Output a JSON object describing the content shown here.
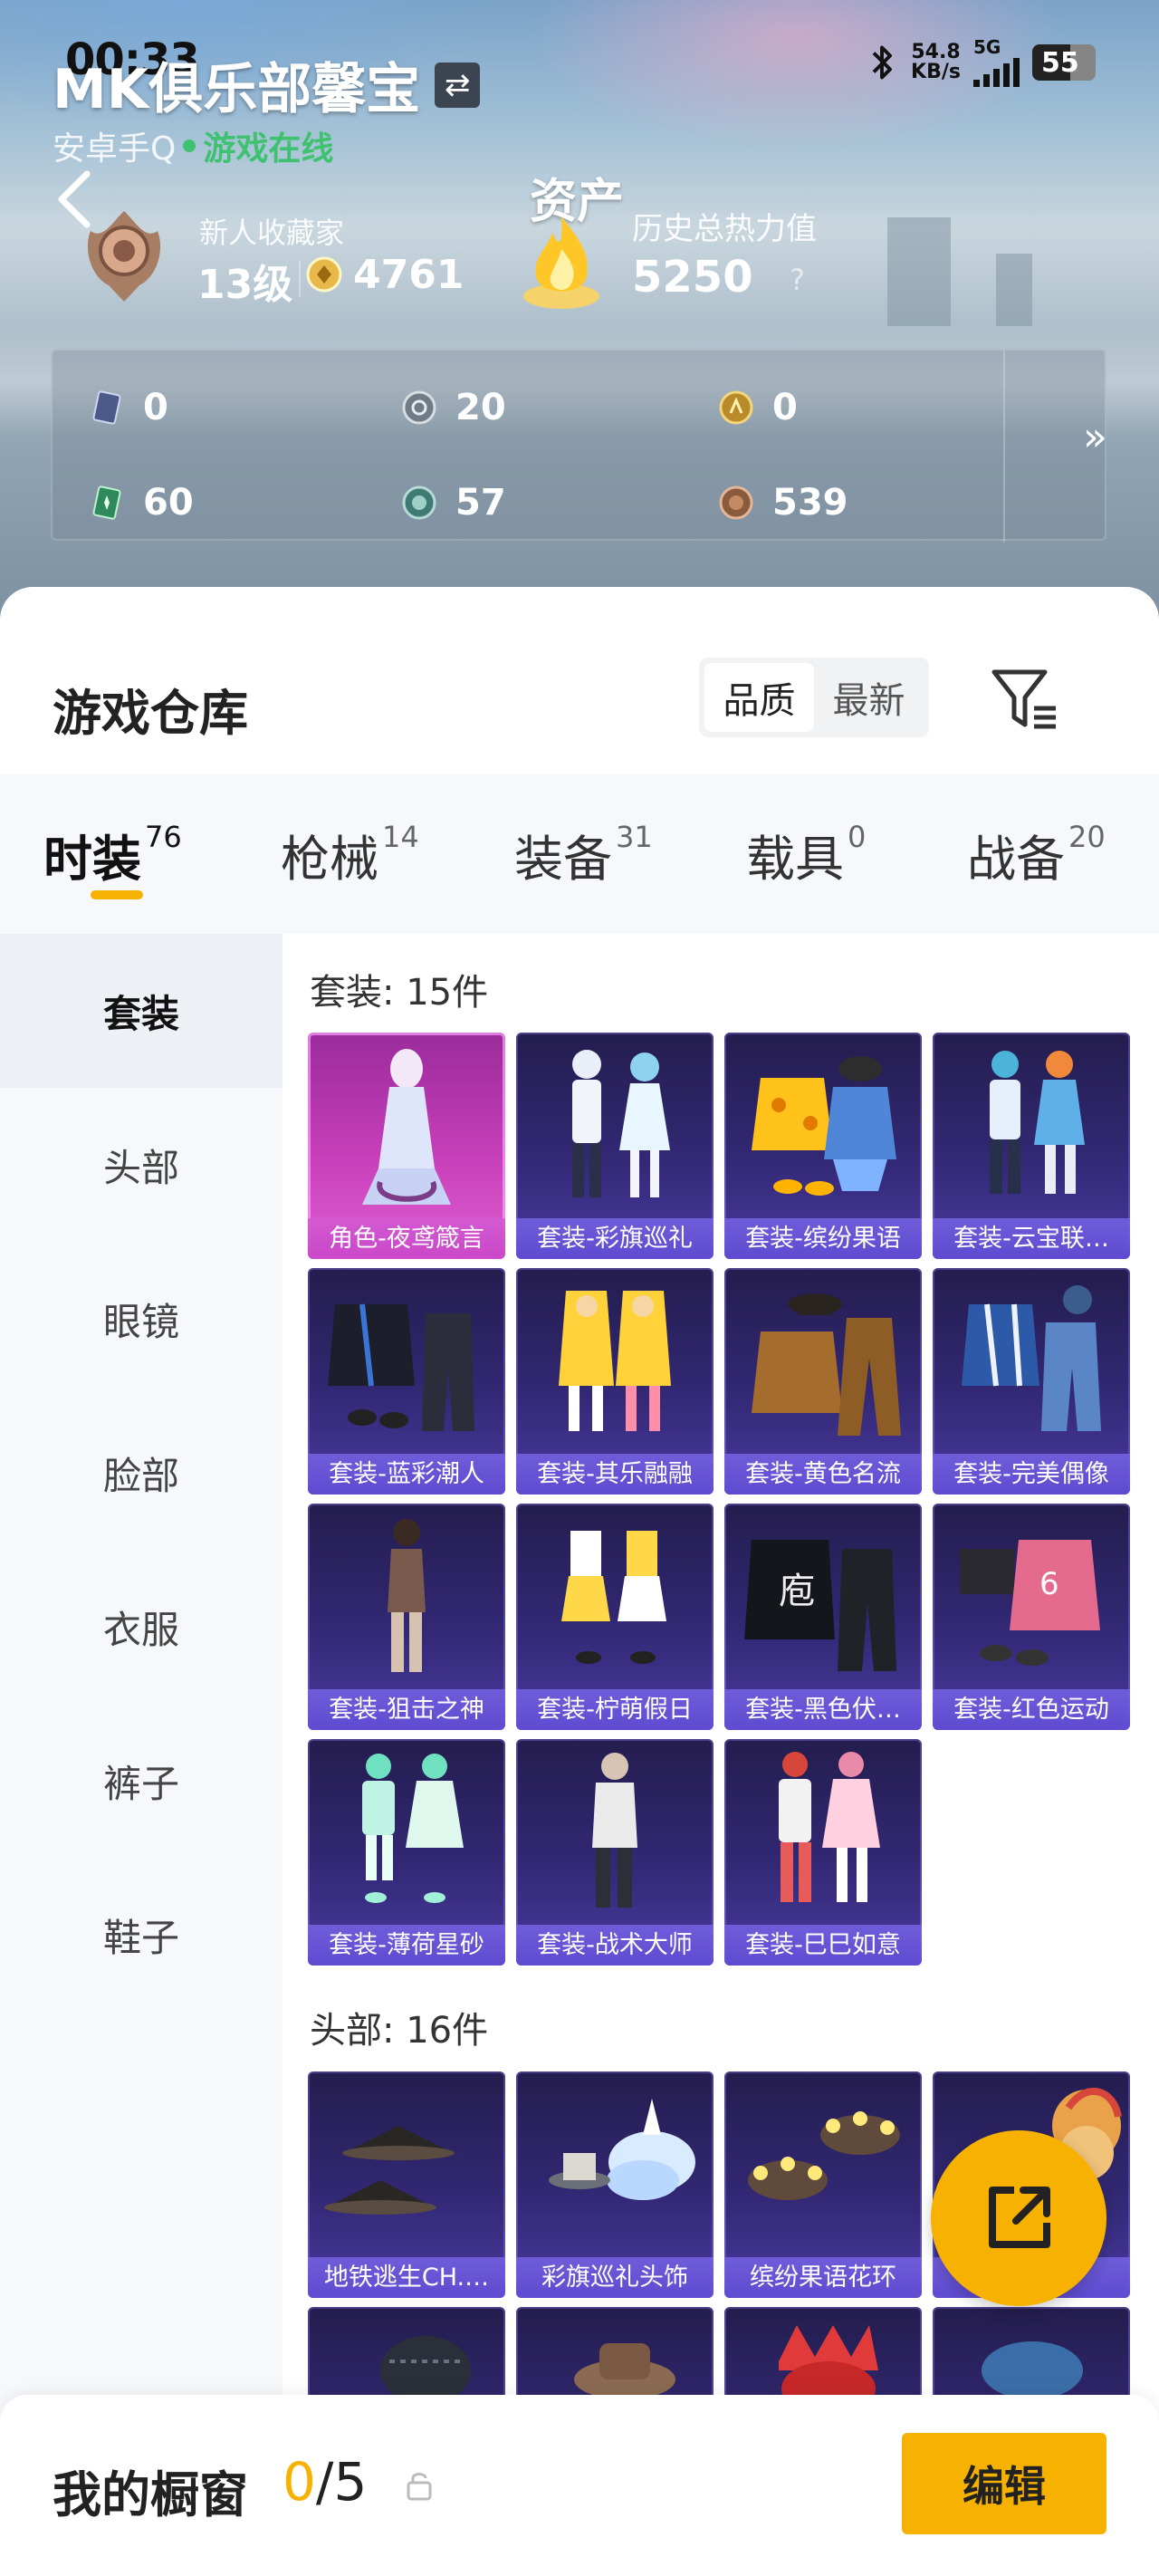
{
  "status_bar": {
    "time": "00:33",
    "speed_value": "54.8",
    "speed_unit": "KB/s",
    "network": "5G",
    "battery": "55"
  },
  "profile": {
    "club_name": "MK俱乐部馨宝",
    "platform": "安卓手Q",
    "online_status": "游戏在线",
    "assets_label": "资产",
    "rank_title": "新人收藏家",
    "level": "13级",
    "coins": "4761",
    "heat_title": "历史总热力值",
    "heat_value": "5250",
    "help": "?"
  },
  "stats": [
    {
      "icon": "card-icon",
      "value": "0"
    },
    {
      "icon": "silver-coin-icon",
      "value": "20"
    },
    {
      "icon": "gold-coin-icon",
      "value": "0"
    },
    {
      "icon": "green-card-icon",
      "value": "60"
    },
    {
      "icon": "teal-coin-icon",
      "value": "57"
    },
    {
      "icon": "bronze-coin-icon",
      "value": "539"
    }
  ],
  "warehouse": {
    "title": "游戏仓库",
    "sort_options": [
      "品质",
      "最新"
    ],
    "sort_selected": "品质"
  },
  "tabs": [
    {
      "label": "时装",
      "count": "76",
      "active": true
    },
    {
      "label": "枪械",
      "count": "14"
    },
    {
      "label": "装备",
      "count": "31"
    },
    {
      "label": "载具",
      "count": "0"
    },
    {
      "label": "战备",
      "count": "20"
    }
  ],
  "sidebar": [
    "套装",
    "头部",
    "眼镜",
    "脸部",
    "衣服",
    "裤子",
    "鞋子"
  ],
  "sections": [
    {
      "title": "套装: 15件",
      "items": [
        "角色-夜鸢箴言",
        "套装-彩旗巡礼",
        "套装-缤纷果语",
        "套装-云宝联…",
        "套装-蓝彩潮人",
        "套装-其乐融融",
        "套装-黄色名流",
        "套装-完美偶像",
        "套装-狙击之神",
        "套装-柠萌假日",
        "套装-黑色伏…",
        "套装-红色运动",
        "套装-薄荷星砂",
        "套装-战术大师",
        "套装-巳巳如意"
      ]
    },
    {
      "title": "头部: 16件",
      "items": [
        "地铁逃生CH.…",
        "彩旗巡礼头饰",
        "缤纷果语花环",
        "…"
      ]
    }
  ],
  "bottom": {
    "showcase_label": "我的橱窗",
    "showcase_current": "0",
    "showcase_total": "/5",
    "edit_label": "编辑"
  },
  "colors": {
    "accent": "#f7b100",
    "online": "#3fc270",
    "card_bg": "#322874",
    "card_special": "#c73fba"
  }
}
